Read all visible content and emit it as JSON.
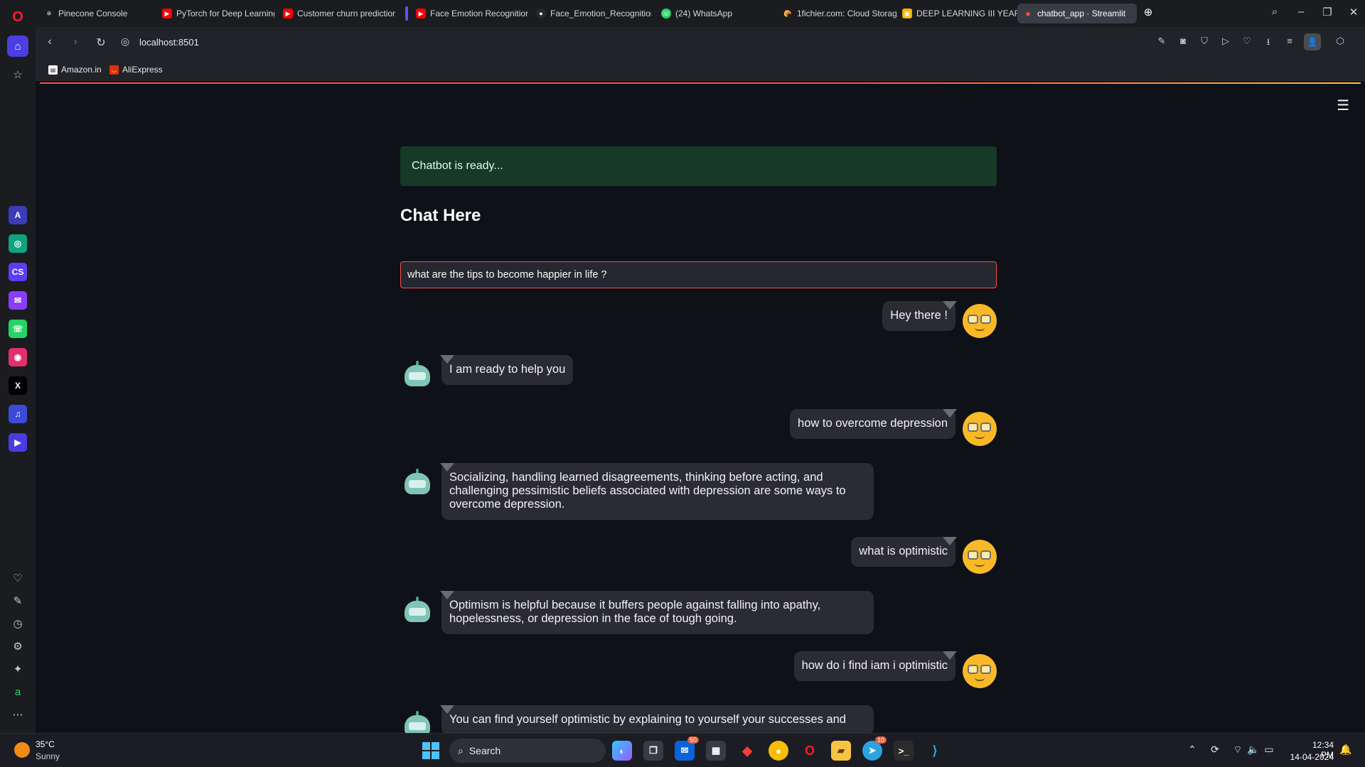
{
  "browser": {
    "tabs": [
      {
        "label": "Pinecone Console",
        "icon": "pinecone-icon",
        "color": "#cfcfcf"
      },
      {
        "label": "PyTorch for Deep Learning",
        "icon": "youtube-icon",
        "color": "#ff0000"
      },
      {
        "label": "Customer churn prediction",
        "icon": "youtube-icon",
        "color": "#ff0000"
      },
      {
        "label": "Face Emotion Recognition",
        "icon": "youtube-icon",
        "color": "#ff0000"
      },
      {
        "label": "Face_Emotion_Recognition",
        "icon": "github-icon",
        "color": "#ffffff"
      },
      {
        "label": "(24) WhatsApp",
        "icon": "whatsapp-icon",
        "color": "#25d366"
      },
      {
        "label": "1fichier.com: Cloud Storag",
        "icon": "fichier-icon",
        "color": "#e08a1e"
      },
      {
        "label": "DEEP LEARNING III YEAR I",
        "icon": "slides-icon",
        "color": "#f4b400"
      },
      {
        "label": "chatbot_app · Streamlit",
        "icon": "streamlit-icon",
        "color": "#ff4b4b"
      }
    ],
    "url": "localhost:8501",
    "bookmarks": [
      {
        "label": "Amazon.in",
        "icon": "page-icon"
      },
      {
        "label": "AliExpress",
        "icon": "aliexpress-icon"
      }
    ]
  },
  "app": {
    "status_alert": "Chatbot is ready...",
    "heading": "Chat Here",
    "input_value": "what are the tips to become happier in life ?",
    "messages": [
      {
        "role": "user",
        "text": "Hey there !"
      },
      {
        "role": "bot",
        "text": "I am ready to help you"
      },
      {
        "role": "user",
        "text": "how to overcome depression"
      },
      {
        "role": "bot",
        "text": "Socializing, handling learned disagreements, thinking before acting, and challenging pessimistic beliefs associated with depression are some ways to overcome depression."
      },
      {
        "role": "user",
        "text": "what is optimistic"
      },
      {
        "role": "bot",
        "text": "Optimism is helpful because it buffers people against falling into apathy, hopelessness, or depression in the face of tough going."
      },
      {
        "role": "user",
        "text": "how do i find iam i optimistic"
      },
      {
        "role": "bot",
        "text": "You can find yourself optimistic by explaining to yourself your successes and"
      }
    ]
  },
  "taskbar": {
    "weather_temp": "35°C",
    "weather_desc": "Sunny",
    "search_label": "Search",
    "mail_badge": "50",
    "telegram_badge": "10",
    "time": "12:34 PM",
    "date": "14-04-2024"
  },
  "colors": {
    "accent": "#ff4b4b",
    "success_bg": "#173928",
    "app_bg": "#0e1117"
  }
}
